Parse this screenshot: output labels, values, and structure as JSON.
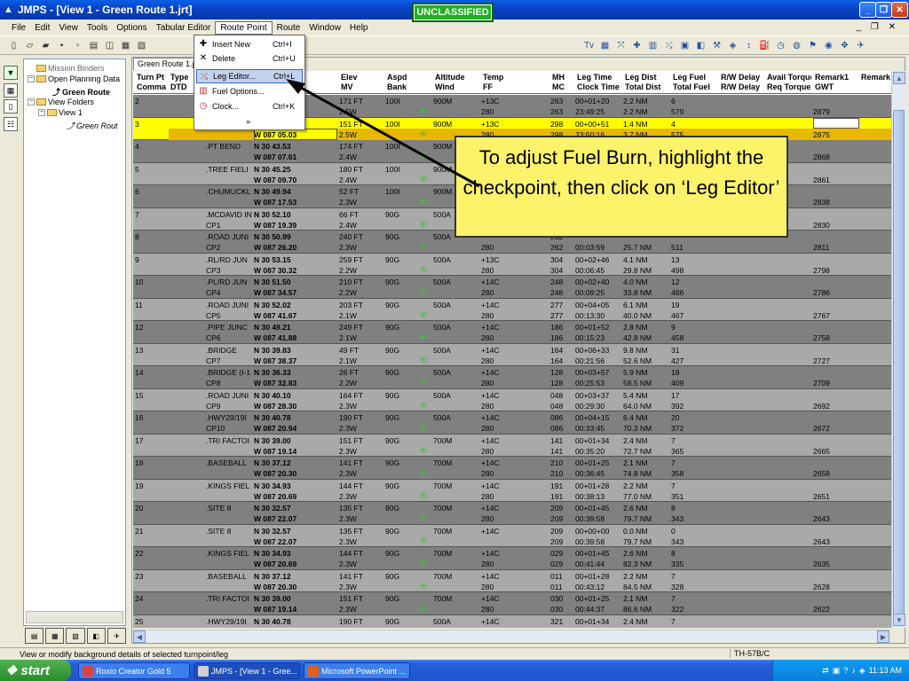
{
  "window": {
    "title": "JMPS - [View 1 - Green Route 1.jrt]",
    "classification": "UNCLASSIFIED",
    "controls": {
      "minimize": "_",
      "restore": "❐",
      "close": "✕"
    }
  },
  "menubar": {
    "items": [
      "File",
      "Edit",
      "View",
      "Tools",
      "Options",
      "Tabular Editor",
      "Route Point",
      "Route",
      "Window",
      "Help"
    ],
    "active": "Route Point",
    "mdi_controls": "_ ❐ ✕"
  },
  "route_point_menu": {
    "items": [
      {
        "label": "Insert New",
        "shortcut": "Ctrl+I",
        "icon": "insert-icon"
      },
      {
        "label": "Delete",
        "shortcut": "Ctrl+U",
        "icon": "delete-icon"
      },
      {
        "label": "Leg Editor...",
        "shortcut": "Ctrl+L",
        "icon": "leg-editor-icon",
        "highlighted": true
      },
      {
        "label": "Fuel Options...",
        "shortcut": "",
        "icon": "fuel-icon"
      },
      {
        "label": "Clock...",
        "shortcut": "Ctrl+K",
        "icon": "clock-icon"
      }
    ],
    "more": "»"
  },
  "tree": {
    "nodes": [
      {
        "label": "Mission Binders",
        "level": 0
      },
      {
        "label": "Open Planning Data",
        "level": 0
      },
      {
        "label": "Green Route",
        "level": 1,
        "bold": true
      },
      {
        "label": "View Folders",
        "level": 0
      },
      {
        "label": "View 1",
        "level": 1
      },
      {
        "label": "Green Rout",
        "level": 2,
        "italic": true
      }
    ]
  },
  "tab_label": "Green Route 1.jr",
  "table": {
    "headers": [
      [
        "Turn Pt",
        "Comma"
      ],
      [
        "Type",
        "DTD"
      ],
      [
        "",
        ""
      ],
      [
        "",
        ""
      ],
      [
        "Elev",
        "MV"
      ],
      [
        "Aspd",
        "Bank"
      ],
      [
        "Altitude",
        "Wind"
      ],
      [
        "Temp",
        "FF"
      ],
      [
        "MH",
        "MC"
      ],
      [
        "Leg Time",
        "Clock Time"
      ],
      [
        "Leg Dist",
        "Total Dist"
      ],
      [
        "Leg Fuel",
        "Total Fuel"
      ],
      [
        "R/W Delay",
        "R/W Delay"
      ],
      [
        "Avail Torque",
        "Req Torque"
      ],
      [
        "Remark1",
        "GWT"
      ],
      [
        "Remark",
        ""
      ]
    ],
    "rows": [
      {
        "n": "2",
        "name": "",
        "cp": "",
        "lat": "",
        "lon": "",
        "elev": "171 FT",
        "mv": "2.5W",
        "aspd": "100I",
        "bank": "",
        "alt": "900M",
        "temp": "+13C",
        "ff": "280",
        "mh": "263",
        "mc": "263",
        "lt": "00+01+20",
        "ct": "23:49:25",
        "ld": "2.2 NM",
        "td": "2.2 NM",
        "lf": "6",
        "tf": "579",
        "gwt": "2879",
        "style": "dark"
      },
      {
        "n": "3",
        "name": "",
        "cp": "",
        "lat": "",
        "lon": "W 087 05.03",
        "elev": "151 FT",
        "mv": "2.5W",
        "aspd": "100I",
        "bank": "",
        "alt": "900M",
        "temp": "+13C",
        "ff": "280",
        "mh": "298",
        "mc": "298",
        "lt": "00+00+51",
        "ct": "23:50:16",
        "ld": "1.4 NM",
        "td": "3.7 NM",
        "lf": "4",
        "tf": "575",
        "gwt": "2875",
        "style": "sel"
      },
      {
        "n": "4",
        "name": ".PT BEND",
        "cp": "",
        "lat": "N 30 43.53",
        "lon": "W 087 07.61",
        "elev": "174 FT",
        "mv": "2.4W",
        "aspd": "100I",
        "bank": "",
        "alt": "900M",
        "temp": "",
        "ff": "",
        "mh": "",
        "mc": "",
        "lt": "",
        "ct": "",
        "ld": "",
        "td": "",
        "lf": "",
        "tf": "",
        "gwt": "2868",
        "style": "dark"
      },
      {
        "n": "5",
        "name": ".TREE FIELI",
        "cp": "",
        "lat": "N 30 45.25",
        "lon": "W 087 09.70",
        "elev": "180 FT",
        "mv": "2.4W",
        "aspd": "100I",
        "bank": "",
        "alt": "900M",
        "temp": "",
        "ff": "",
        "mh": "",
        "mc": "",
        "lt": "",
        "ct": "",
        "ld": "",
        "td": "",
        "lf": "",
        "tf": "",
        "gwt": "2861",
        "style": "light"
      },
      {
        "n": "6",
        "name": ".CHUMUCKL",
        "cp": "",
        "lat": "N 30 49.94",
        "lon": "W 087 17.53",
        "elev": "52 FT",
        "mv": "2.3W",
        "aspd": "100I",
        "bank": "",
        "alt": "900M",
        "temp": "",
        "ff": "",
        "mh": "",
        "mc": "",
        "lt": "",
        "ct": "",
        "ld": "",
        "td": "",
        "lf": "",
        "tf": "",
        "gwt": "2838",
        "style": "dark"
      },
      {
        "n": "7",
        "name": ".MCDAVID IN",
        "cp": "CP1",
        "lat": "N 30 52.10",
        "lon": "W 087 19.39",
        "elev": "66 FT",
        "mv": "2.4W",
        "aspd": "90G",
        "bank": "",
        "alt": "500A",
        "temp": "",
        "ff": "",
        "mh": "",
        "mc": "",
        "lt": "",
        "ct": "",
        "ld": "",
        "td": "",
        "lf": "",
        "tf": "",
        "gwt": "2830",
        "style": "light"
      },
      {
        "n": "8",
        "name": ".ROAD JUNI",
        "cp": "CP2",
        "lat": "N 30 50.99",
        "lon": "W 087 26.20",
        "elev": "240 FT",
        "mv": "2.3W",
        "aspd": "90G",
        "bank": "",
        "alt": "500A",
        "temp": "",
        "ff": "280",
        "mh": "262",
        "mc": "262",
        "lt": "",
        "ct": "00:03:59",
        "ld": "",
        "td": "25.7 NM",
        "lf": "",
        "tf": "511",
        "gwt": "2811",
        "style": "dark"
      },
      {
        "n": "9",
        "name": ".RL/RD JUN",
        "cp": "CP3",
        "lat": "N 30 53.15",
        "lon": "W 087 30.32",
        "elev": "259 FT",
        "mv": "2.2W",
        "aspd": "90G",
        "bank": "",
        "alt": "500A",
        "temp": "+13C",
        "ff": "280",
        "mh": "304",
        "mc": "304",
        "lt": "00+02+46",
        "ct": "00:06:45",
        "ld": "4.1 NM",
        "td": "29.8 NM",
        "lf": "13",
        "tf": "498",
        "gwt": "2798",
        "style": "light"
      },
      {
        "n": "10",
        "name": ".PL/RD JUN",
        "cp": "CP4",
        "lat": "N 30 51.50",
        "lon": "W 087 34.57",
        "elev": "210 FT",
        "mv": "2.2W",
        "aspd": "90G",
        "bank": "",
        "alt": "500A",
        "temp": "+14C",
        "ff": "280",
        "mh": "248",
        "mc": "248",
        "lt": "00+02+40",
        "ct": "00:09:25",
        "ld": "4.0 NM",
        "td": "33.8 NM",
        "lf": "12",
        "tf": "486",
        "gwt": "2786",
        "style": "dark"
      },
      {
        "n": "11",
        "name": ".ROAD JUNI",
        "cp": "CP5",
        "lat": "N 30 52.02",
        "lon": "W 087 41.67",
        "elev": "203 FT",
        "mv": "2.1W",
        "aspd": "90G",
        "bank": "",
        "alt": "500A",
        "temp": "+14C",
        "ff": "280",
        "mh": "277",
        "mc": "277",
        "lt": "00+04+05",
        "ct": "00:13:30",
        "ld": "6.1 NM",
        "td": "40.0 NM",
        "lf": "19",
        "tf": "467",
        "gwt": "2767",
        "style": "light"
      },
      {
        "n": "12",
        "name": ".PIPE JUNC",
        "cp": "CP6",
        "lat": "N 30 49.21",
        "lon": "W 087 41.88",
        "elev": "249 FT",
        "mv": "2.1W",
        "aspd": "90G",
        "bank": "",
        "alt": "500A",
        "temp": "+14C",
        "ff": "280",
        "mh": "186",
        "mc": "186",
        "lt": "00+01+52",
        "ct": "00:15:23",
        "ld": "2.8 NM",
        "td": "42.8 NM",
        "lf": "9",
        "tf": "458",
        "gwt": "2758",
        "style": "dark"
      },
      {
        "n": "13",
        "name": ".BRIDGE",
        "cp": "CP7",
        "lat": "N 30 39.83",
        "lon": "W 087 38.37",
        "elev": "49 FT",
        "mv": "2.1W",
        "aspd": "90G",
        "bank": "",
        "alt": "500A",
        "temp": "+14C",
        "ff": "280",
        "mh": "164",
        "mc": "164",
        "lt": "00+06+33",
        "ct": "00:21:56",
        "ld": "9.8 NM",
        "td": "52.6 NM",
        "lf": "31",
        "tf": "427",
        "gwt": "2727",
        "style": "light"
      },
      {
        "n": "14",
        "name": ".BRIDGE (I-1",
        "cp": "CP8",
        "lat": "N 30 36.33",
        "lon": "W 087 32.83",
        "elev": "26 FT",
        "mv": "2.2W",
        "aspd": "90G",
        "bank": "",
        "alt": "500A",
        "temp": "+14C",
        "ff": "280",
        "mh": "128",
        "mc": "128",
        "lt": "00+03+57",
        "ct": "00:25:53",
        "ld": "5.9 NM",
        "td": "58.5 NM",
        "lf": "18",
        "tf": "409",
        "gwt": "2709",
        "style": "dark"
      },
      {
        "n": "15",
        "name": ".ROAD JUNI",
        "cp": "CP9",
        "lat": "N 30 40.10",
        "lon": "W 087 28.30",
        "elev": "164 FT",
        "mv": "2.3W",
        "aspd": "90G",
        "bank": "",
        "alt": "500A",
        "temp": "+14C",
        "ff": "280",
        "mh": "048",
        "mc": "048",
        "lt": "00+03+37",
        "ct": "00:29:30",
        "ld": "5.4 NM",
        "td": "64.0 NM",
        "lf": "17",
        "tf": "392",
        "gwt": "2692",
        "style": "light"
      },
      {
        "n": "16",
        "name": ".HWY29/19I",
        "cp": "CP10",
        "lat": "N 30 40.78",
        "lon": "W 087 20.94",
        "elev": "190 FT",
        "mv": "2.3W",
        "aspd": "90G",
        "bank": "",
        "alt": "500A",
        "temp": "+14C",
        "ff": "280",
        "mh": "086",
        "mc": "086",
        "lt": "00+04+15",
        "ct": "00:33:45",
        "ld": "6.4 NM",
        "td": "70.3 NM",
        "lf": "20",
        "tf": "372",
        "gwt": "2672",
        "style": "dark"
      },
      {
        "n": "17",
        "name": ".TRI FACTOI",
        "cp": "",
        "lat": "N 30 39.00",
        "lon": "W 087 19.14",
        "elev": "151 FT",
        "mv": "2.3W",
        "aspd": "90G",
        "bank": "",
        "alt": "700M",
        "temp": "+14C",
        "ff": "280",
        "mh": "141",
        "mc": "141",
        "lt": "00+01+34",
        "ct": "00:35:20",
        "ld": "2.4 NM",
        "td": "72.7 NM",
        "lf": "7",
        "tf": "365",
        "gwt": "2665",
        "style": "light"
      },
      {
        "n": "18",
        "name": ".BASEBALL",
        "cp": "",
        "lat": "N 30 37.12",
        "lon": "W 087 20.30",
        "elev": "141 FT",
        "mv": "2.3W",
        "aspd": "90G",
        "bank": "",
        "alt": "700M",
        "temp": "+14C",
        "ff": "280",
        "mh": "210",
        "mc": "210",
        "lt": "00+01+25",
        "ct": "00:36:45",
        "ld": "2.1 NM",
        "td": "74.8 NM",
        "lf": "7",
        "tf": "358",
        "gwt": "2658",
        "style": "dark"
      },
      {
        "n": "19",
        "name": ".KINGS FIEL",
        "cp": "",
        "lat": "N 30 34.93",
        "lon": "W 087 20.69",
        "elev": "144 FT",
        "mv": "2.3W",
        "aspd": "90G",
        "bank": "",
        "alt": "700M",
        "temp": "+14C",
        "ff": "280",
        "mh": "191",
        "mc": "191",
        "lt": "00+01+28",
        "ct": "00:38:13",
        "ld": "2.2 NM",
        "td": "77.0 NM",
        "lf": "7",
        "tf": "351",
        "gwt": "2651",
        "style": "light"
      },
      {
        "n": "20",
        "name": ".SITE 8",
        "cp": "",
        "lat": "N 30 32.57",
        "lon": "W 087 22.07",
        "elev": "135 FT",
        "mv": "2.3W",
        "aspd": "90G",
        "bank": "",
        "alt": "700M",
        "temp": "+14C",
        "ff": "280",
        "mh": "209",
        "mc": "209",
        "lt": "00+01+45",
        "ct": "00:39:58",
        "ld": "2.6 NM",
        "td": "79.7 NM",
        "lf": "8",
        "tf": "343",
        "gwt": "2643",
        "style": "dark"
      },
      {
        "n": "21",
        "name": ".SITE 8",
        "cp": "",
        "lat": "N 30 32.57",
        "lon": "W 087 22.07",
        "elev": "135 FT",
        "mv": "2.3W",
        "aspd": "90G",
        "bank": "",
        "alt": "700M",
        "temp": "+14C",
        "ff": "",
        "mh": "209",
        "mc": "209",
        "lt": "00+00+00",
        "ct": "00:39:58",
        "ld": "0.0 NM",
        "td": "79.7 NM",
        "lf": "0",
        "tf": "343",
        "gwt": "2643",
        "style": "light"
      },
      {
        "n": "22",
        "name": ".KINGS FIEL",
        "cp": "",
        "lat": "N 30 34.93",
        "lon": "W 087 20.69",
        "elev": "144 FT",
        "mv": "2.3W",
        "aspd": "90G",
        "bank": "",
        "alt": "700M",
        "temp": "+14C",
        "ff": "280",
        "mh": "029",
        "mc": "029",
        "lt": "00+01+45",
        "ct": "00:41:44",
        "ld": "2.6 NM",
        "td": "82.3 NM",
        "lf": "8",
        "tf": "335",
        "gwt": "2635",
        "style": "dark"
      },
      {
        "n": "23",
        "name": ".BASEBALL",
        "cp": "",
        "lat": "N 30 37.12",
        "lon": "W 087 20.30",
        "elev": "141 FT",
        "mv": "2.3W",
        "aspd": "90G",
        "bank": "",
        "alt": "700M",
        "temp": "+14C",
        "ff": "280",
        "mh": "011",
        "mc": "011",
        "lt": "00+01+28",
        "ct": "00:43:12",
        "ld": "2.2 NM",
        "td": "84.5 NM",
        "lf": "7",
        "tf": "328",
        "gwt": "2628",
        "style": "light"
      },
      {
        "n": "24",
        "name": ".TRI FACTOI",
        "cp": "",
        "lat": "N 30 39.00",
        "lon": "W 087 19.14",
        "elev": "151 FT",
        "mv": "2.3W",
        "aspd": "90G",
        "bank": "",
        "alt": "700M",
        "temp": "+14C",
        "ff": "280",
        "mh": "030",
        "mc": "030",
        "lt": "00+01+25",
        "ct": "00:44:37",
        "ld": "2.1 NM",
        "td": "86.6 NM",
        "lf": "7",
        "tf": "322",
        "gwt": "2622",
        "style": "dark"
      },
      {
        "n": "25",
        "name": ".HWY29/19I",
        "cp": "",
        "lat": "N 30 40.78",
        "lon": "",
        "elev": "190 FT",
        "mv": "",
        "aspd": "90G",
        "bank": "",
        "alt": "500A",
        "temp": "+14C",
        "ff": "",
        "mh": "321",
        "mc": "",
        "lt": "00+01+34",
        "ct": "",
        "ld": "2.4 NM",
        "td": "",
        "lf": "7",
        "tf": "",
        "gwt": "",
        "style": "light"
      }
    ]
  },
  "callout": {
    "text": "To adjust Fuel Burn, highlight the checkpoint, then click on ‘Leg Editor’"
  },
  "statusbar": {
    "message": "View or modify background details of selected turnpoint/leg",
    "aircraft": "TH-57B/C"
  },
  "taskbar": {
    "start_label": "start",
    "tasks": [
      {
        "label": "Roxio Creator Gold 5",
        "active": false
      },
      {
        "label": "JMPS - [View 1 - Gree...",
        "active": true
      },
      {
        "label": "Microsoft PowerPoint ...",
        "active": false
      }
    ],
    "clock": "11:13 AM"
  },
  "colors": {
    "title_blue": "#0845c8",
    "selected_row": "#ffff00",
    "callout_bg": "#fdf36a",
    "unclassified_green": "#20b020"
  }
}
